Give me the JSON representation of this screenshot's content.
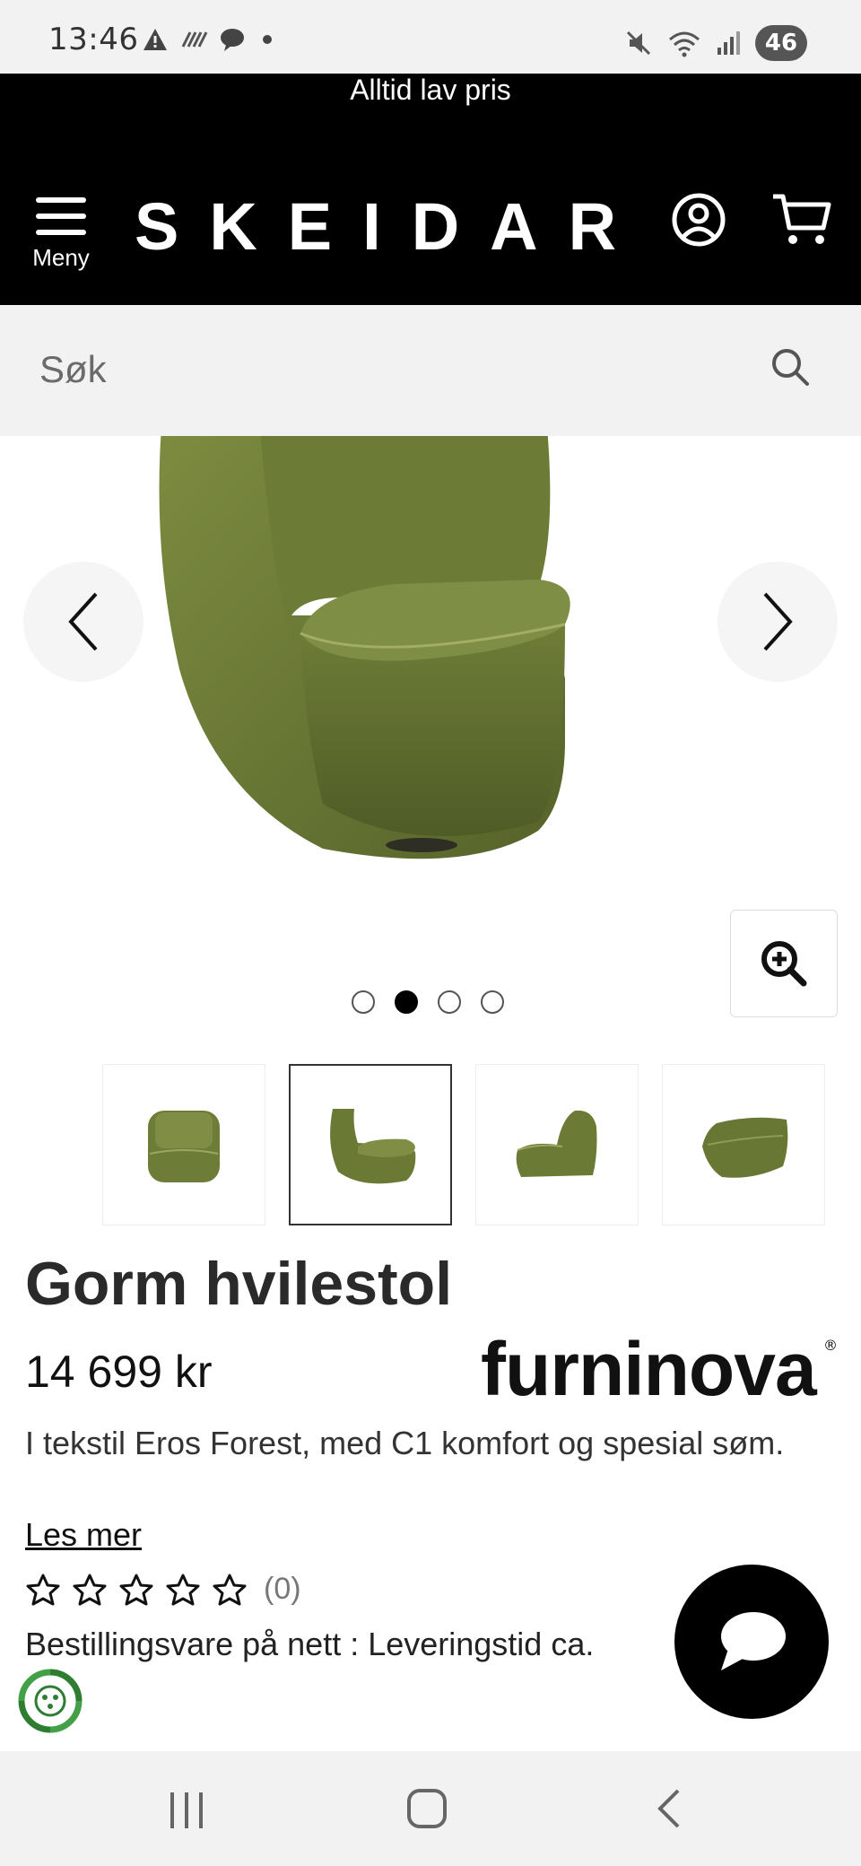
{
  "status_bar": {
    "time": "13:46",
    "battery": "46",
    "left_icons": [
      "warning-icon",
      "wifi-calling-icon",
      "chat-bubble-icon",
      "dot-icon"
    ],
    "right_icons": [
      "mute-icon",
      "wifi-icon",
      "signal-icon"
    ]
  },
  "header": {
    "promo_text": "Alltid lav pris",
    "menu_label": "Meny",
    "logo_text": "SKEIDAR",
    "background_color": "#000000"
  },
  "search": {
    "placeholder": "Søk"
  },
  "gallery": {
    "total_images": 4,
    "active_index": 1,
    "dots": [
      "",
      "",
      "",
      ""
    ],
    "thumbnails": [
      "chair-front",
      "chair-angle",
      "chair-side",
      "chair-back"
    ],
    "selected_thumbnail": 1
  },
  "product": {
    "title": "Gorm hvilestol",
    "price": "14 699 kr",
    "brand": "furninova",
    "description": "I tekstil Eros Forest, med C1 komfort og spesial søm.",
    "read_more": "Les mer",
    "rating": 0,
    "rating_max": 5,
    "review_count": "(0)",
    "availability": "Bestillingsvare på nett : Leveringstid ca."
  },
  "colors": {
    "chair_green": "#6b7a35",
    "header_black": "#000000",
    "search_bg": "#f2f2f2"
  }
}
